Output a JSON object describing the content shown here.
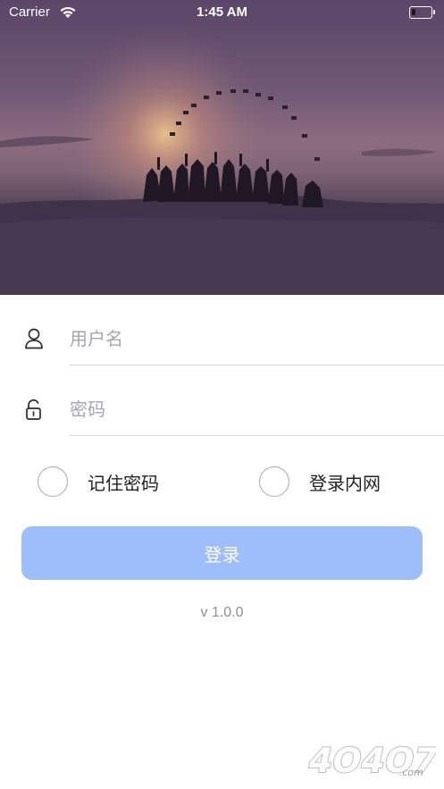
{
  "status_bar": {
    "carrier": "Carrier",
    "time": "1:45 AM",
    "battery_level": 0.2
  },
  "hero": {
    "image_semantic": "graduates-silhouette-sunset"
  },
  "login_form": {
    "username_placeholder": "用户名",
    "username_value": "",
    "password_placeholder": "密码",
    "password_value": "",
    "remember_label": "记住密码",
    "remember_checked": false,
    "intranet_label": "登录内网",
    "intranet_checked": false,
    "submit_label": "登录"
  },
  "version": "v 1.0.0",
  "watermark": {
    "text": "4O4O7.com"
  },
  "colors": {
    "button": "#9dbefb",
    "placeholder": "#a7a7ab",
    "divider": "#d8d8dc"
  },
  "icons": {
    "username": "person-icon",
    "password": "lock-icon",
    "wifi": "wifi-icon",
    "battery": "battery-icon"
  }
}
